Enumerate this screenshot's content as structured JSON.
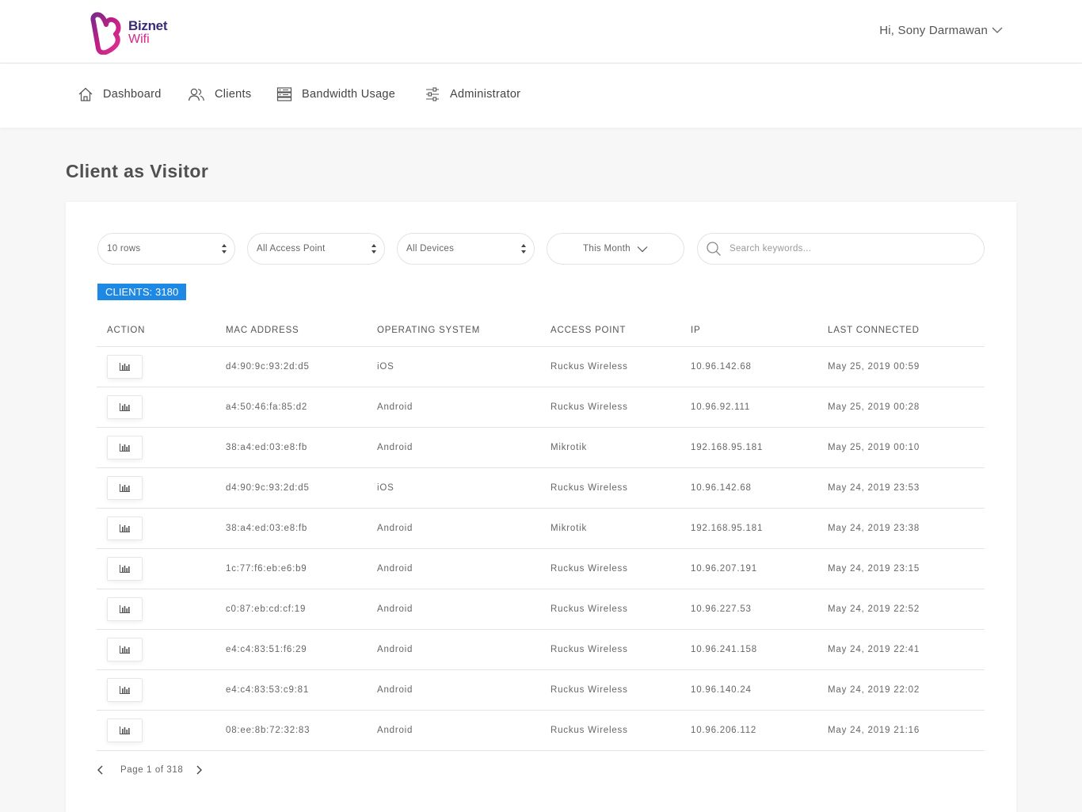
{
  "brand": {
    "name": "Biznet",
    "sub": "Wifi"
  },
  "user": {
    "greeting": "Hi, Sony Darmawan"
  },
  "nav": {
    "dashboard": "Dashboard",
    "clients": "Clients",
    "bandwidth": "Bandwidth Usage",
    "administrator": "Administrator"
  },
  "page": {
    "title": "Client as Visitor"
  },
  "filters": {
    "rows": "10 rows",
    "access_point": "All Access Point",
    "devices": "All Devices",
    "period": "This Month",
    "search_placeholder": "Search keywords..."
  },
  "badge": "CLIENTS: 3180",
  "columns": [
    "ACTION",
    "MAC ADDRESS",
    "OPERATING SYSTEM",
    "ACCESS POINT",
    "IP",
    "LAST CONNECTED"
  ],
  "rows": [
    {
      "mac": "d4:90:9c:93:2d:d5",
      "os": "iOS",
      "ap": "Ruckus Wireless",
      "ip": "10.96.142.68",
      "last": "May 25, 2019 00:59"
    },
    {
      "mac": "a4:50:46:fa:85:d2",
      "os": "Android",
      "ap": "Ruckus Wireless",
      "ip": "10.96.92.111",
      "last": "May 25, 2019 00:28"
    },
    {
      "mac": "38:a4:ed:03:e8:fb",
      "os": "Android",
      "ap": "Mikrotik",
      "ip": "192.168.95.181",
      "last": "May 25, 2019 00:10"
    },
    {
      "mac": "d4:90:9c:93:2d:d5",
      "os": "iOS",
      "ap": "Ruckus Wireless",
      "ip": "10.96.142.68",
      "last": "May 24, 2019 23:53"
    },
    {
      "mac": "38:a4:ed:03:e8:fb",
      "os": "Android",
      "ap": "Mikrotik",
      "ip": "192.168.95.181",
      "last": "May 24, 2019 23:38"
    },
    {
      "mac": "1c:77:f6:eb:e6:b9",
      "os": "Android",
      "ap": "Ruckus Wireless",
      "ip": "10.96.207.191",
      "last": "May 24, 2019 23:15"
    },
    {
      "mac": "c0:87:eb:cd:cf:19",
      "os": "Android",
      "ap": "Ruckus Wireless",
      "ip": "10.96.227.53",
      "last": "May 24, 2019 22:52"
    },
    {
      "mac": "e4:c4:83:51:f6:29",
      "os": "Android",
      "ap": "Ruckus Wireless",
      "ip": "10.96.241.158",
      "last": "May 24, 2019 22:41"
    },
    {
      "mac": "e4:c4:83:53:c9:81",
      "os": "Android",
      "ap": "Ruckus Wireless",
      "ip": "10.96.140.24",
      "last": "May 24, 2019 22:02"
    },
    {
      "mac": "08:ee:8b:72:32:83",
      "os": "Android",
      "ap": "Ruckus Wireless",
      "ip": "10.96.206.112",
      "last": "May 24, 2019 21:16"
    }
  ],
  "pagination": {
    "label": "Page 1 of 318"
  },
  "colors": {
    "accent": "#1e88e5",
    "brand_pink": "#d4288a",
    "brand_purple": "#3b2b7a"
  }
}
